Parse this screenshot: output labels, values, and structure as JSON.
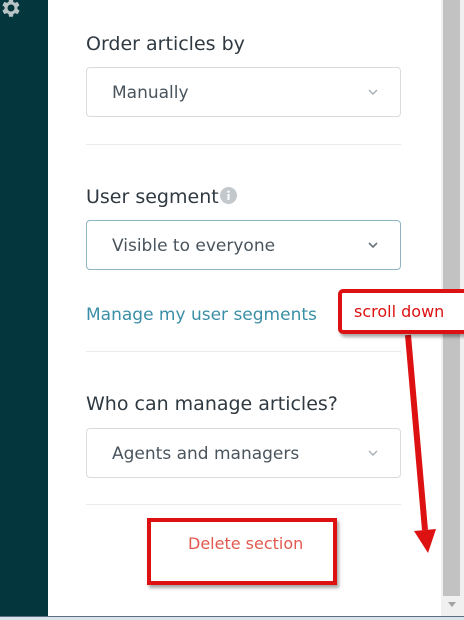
{
  "settings": {
    "order_by": {
      "label": "Order articles by",
      "value": "Manually"
    },
    "user_segment": {
      "label": "User segment",
      "value": "Visible to everyone",
      "info_icon": "info-icon"
    },
    "manage_segments_link": "Manage my user segments",
    "managers": {
      "label": "Who can manage articles?",
      "value": "Agents and managers"
    },
    "delete_label": "Delete section"
  },
  "annotation": {
    "callout_text": "scroll down",
    "color": "#dd1111"
  },
  "colors": {
    "sidebar": "#03363d",
    "link": "#3a8fa6",
    "danger": "#e3594f"
  }
}
